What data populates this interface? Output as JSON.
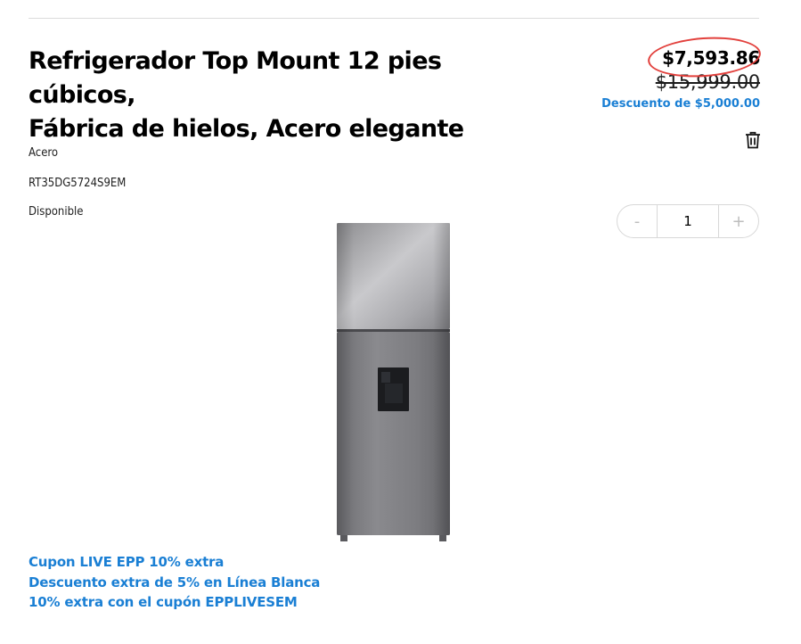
{
  "product": {
    "title_line1": "Refrigerador Top Mount 12 pies cúbicos,",
    "title_line2": "Fábrica de hielos, Acero elegante",
    "color": "Acero",
    "model": "RT35DG5724S9EM",
    "availability": "Disponible"
  },
  "pricing": {
    "price": "$7,593.86",
    "original_price": "$15,999.00",
    "discount": "Descuento de $5,000.00"
  },
  "quantity": {
    "minus": "-",
    "value": "1",
    "plus": "+"
  },
  "icons": {
    "remove": "trash-icon"
  },
  "promotions": [
    "Cupon LIVE EPP 10% extra",
    "Descuento extra de 5% en Línea Blanca",
    "10% extra con el cupón EPPLIVESEM"
  ],
  "colors": {
    "accent_blue": "#1a7fd4",
    "annotation_red": "#e2403c",
    "divider": "#dcdcdc"
  }
}
